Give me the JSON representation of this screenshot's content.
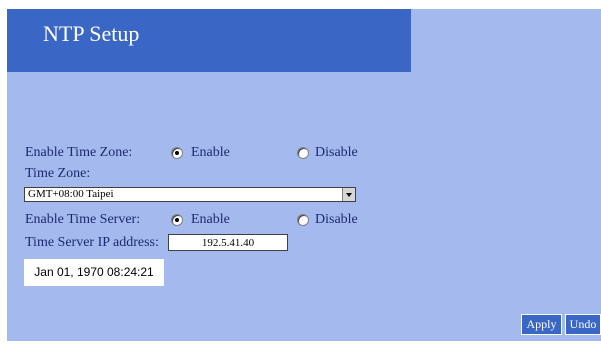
{
  "page": {
    "title": "NTP Setup"
  },
  "timezone_enable": {
    "label": "Enable Time Zone:",
    "enable_label": "Enable",
    "disable_label": "Disable",
    "selected": "Enable"
  },
  "timezone": {
    "label": "Time Zone:",
    "selected": "GMT+08:00 Taipei"
  },
  "timeserver_enable": {
    "label": "Enable Time Server:",
    "enable_label": "Enable",
    "disable_label": "Disable",
    "selected": "Enable"
  },
  "timeserver_ip": {
    "label": "Time Server IP address:",
    "value": "192.5.41.40"
  },
  "clock": {
    "text": "Jan 01, 1970 08:24:21"
  },
  "buttons": {
    "apply_label": "Apply",
    "undo_label": "Undo"
  },
  "colors": {
    "panel_bg": "#a4b9ee",
    "title_bg": "#3a67c6",
    "label_text": "#1e2a6e"
  }
}
